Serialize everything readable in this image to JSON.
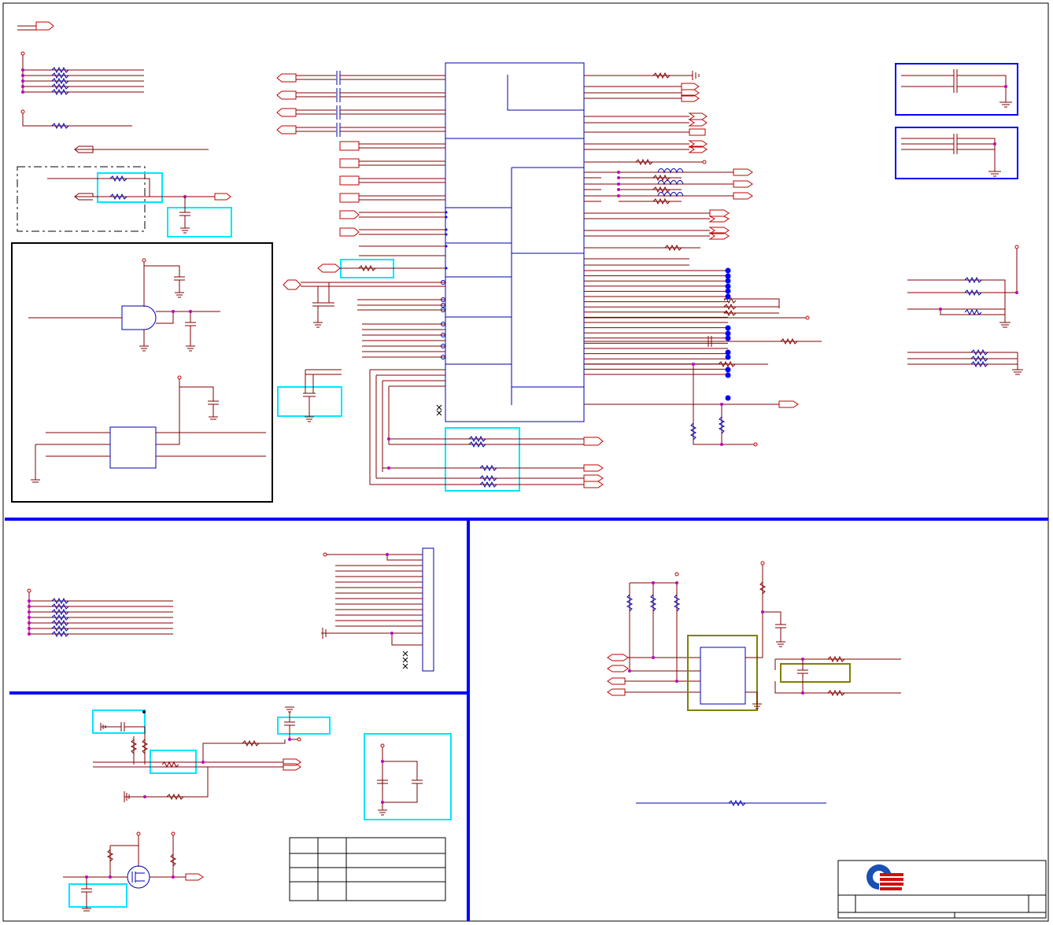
{
  "sheet": {
    "title": "",
    "regions": [
      "top-schematic",
      "connector-panel",
      "interface-panel",
      "bottom-left-panel",
      "title-block"
    ]
  },
  "colors": {
    "wire": "#800000",
    "component": "#0000b0",
    "divider": "#0000ff",
    "highlight": "#00e5ff",
    "highlight_alt": "#808000",
    "junction": "#c000c0",
    "logo_blue": "#1a4fb4",
    "logo_red": "#d01010"
  },
  "logo": {
    "icon": "company-logo-icon"
  },
  "title_block": {
    "fields": [
      "",
      "",
      ""
    ]
  },
  "revision_table": {
    "rows": 4,
    "columns": 3,
    "cells": []
  }
}
